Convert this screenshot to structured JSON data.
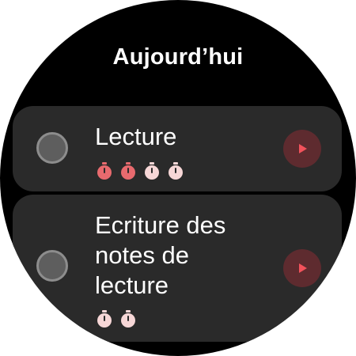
{
  "header": {
    "title": "Aujourd’hui"
  },
  "colors": {
    "background": "#000000",
    "card": "#2a2a2a",
    "checkbox": "#5e5e5e",
    "checkbox_border": "#8d8d8d",
    "play_button": "#5e2b2f",
    "play_icon": "#f2525b",
    "pomodoro_done": "#e86a6e",
    "pomodoro_todo": "#f7d7d7"
  },
  "tasks": [
    {
      "title": "Lecture",
      "completed": false,
      "pomodoros": [
        "done",
        "done",
        "todo",
        "todo"
      ],
      "icons": {
        "checkbox": "circle-checkbox-icon",
        "pomodoro": "timer-icon",
        "action": "play-icon"
      }
    },
    {
      "title": "Ecriture des notes de lecture",
      "completed": false,
      "pomodoros": [
        "todo",
        "todo"
      ],
      "icons": {
        "checkbox": "circle-checkbox-icon",
        "pomodoro": "timer-icon",
        "action": "play-icon"
      }
    }
  ]
}
